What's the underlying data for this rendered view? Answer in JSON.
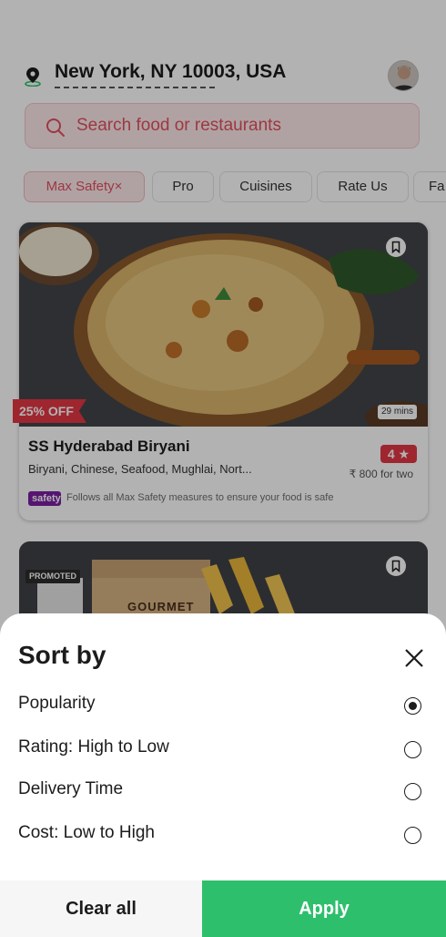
{
  "header": {
    "location": "New York, NY 10003, USA",
    "location_icon": "map-pin-icon",
    "avatar_icon": "user-avatar"
  },
  "search": {
    "placeholder": "Search food or restaurants",
    "icon": "search-icon"
  },
  "chips": [
    {
      "label": "Max Safety",
      "active": true,
      "close": "×"
    },
    {
      "label": "Pro",
      "active": false
    },
    {
      "label": "Cuisines",
      "active": false
    },
    {
      "label": "Rate Us",
      "active": false
    },
    {
      "label": "Fa",
      "active": false
    }
  ],
  "restaurant": {
    "offer": "25% OFF",
    "delivery_time": "29 mins",
    "name": "SS Hyderabad Biryani",
    "rating": "4 ★",
    "cuisines": "Biryani, Chinese, Seafood, Mughlai, Nort...",
    "price": "₹ 800 for two",
    "safety_badge": "safety",
    "safety_text": "Follows all Max Safety measures to ensure your food is safe"
  },
  "restaurant2": {
    "promoted": "PROMOTED",
    "box_text": "GOURMET"
  },
  "sort_sheet": {
    "title": "Sort by",
    "options": [
      {
        "label": "Popularity",
        "selected": true
      },
      {
        "label": "Rating: High to Low",
        "selected": false
      },
      {
        "label": "Delivery Time",
        "selected": false
      },
      {
        "label": "Cost: Low to High",
        "selected": false
      }
    ],
    "clear_label": "Clear all",
    "apply_label": "Apply"
  },
  "colors": {
    "brand_red": "#e23744",
    "apply_green": "#2ebf6d"
  }
}
